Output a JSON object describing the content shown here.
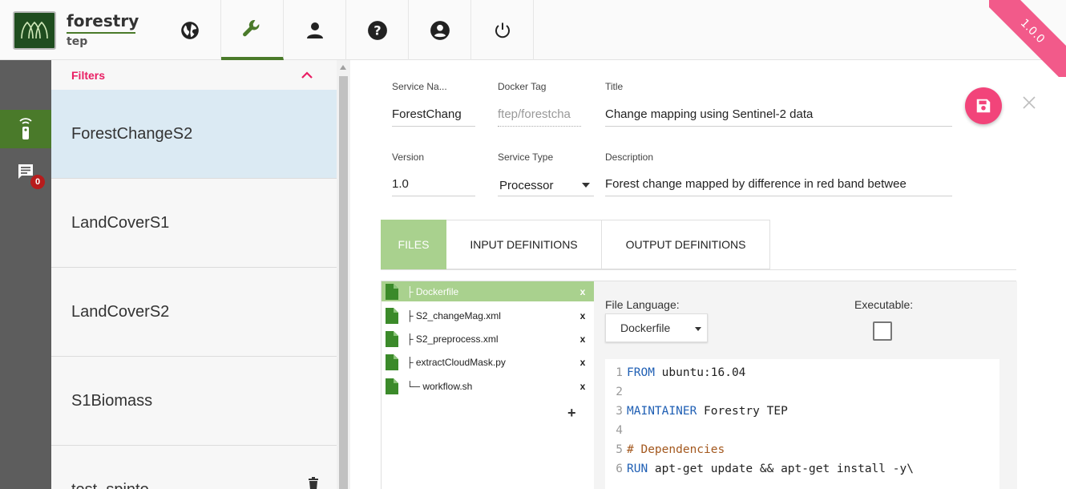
{
  "app": {
    "logo_main": "forestry",
    "logo_sub": "tep",
    "version": "1.0.0"
  },
  "nav": [
    {
      "name": "globe-icon"
    },
    {
      "name": "wrench-icon",
      "active": true
    },
    {
      "name": "user-icon"
    },
    {
      "name": "help-icon"
    },
    {
      "name": "account-circle-icon"
    },
    {
      "name": "power-icon"
    }
  ],
  "rail": {
    "message_badge": "0"
  },
  "list": {
    "filters_label": "Filters",
    "items": [
      {
        "label": "ForestChangeS2",
        "selected": true
      },
      {
        "label": "LandCoverS1"
      },
      {
        "label": "LandCoverS2"
      },
      {
        "label": "S1Biomass"
      },
      {
        "label": "test_spinto"
      }
    ]
  },
  "form": {
    "service_name_label": "Service Na...",
    "service_name": "ForestChang",
    "docker_tag_label": "Docker Tag",
    "docker_tag": "ftep/forestcha",
    "title_label": "Title",
    "title": "Change mapping using Sentinel-2 data",
    "version_label": "Version",
    "version": "1.0",
    "service_type_label": "Service Type",
    "service_type": "Processor",
    "description_label": "Description",
    "description": "Forest change mapped by difference in red band betwee"
  },
  "tabs": [
    {
      "label": "FILES",
      "active": true
    },
    {
      "label": "INPUT DEFINITIONS"
    },
    {
      "label": "OUTPUT DEFINITIONS"
    }
  ],
  "files": {
    "items": [
      {
        "name": "├ Dockerfile",
        "remove": "x",
        "active": true
      },
      {
        "name": "├ S2_changeMag.xml",
        "remove": "x"
      },
      {
        "name": "├ S2_preprocess.xml",
        "remove": "x"
      },
      {
        "name": "├ extractCloudMask.py",
        "remove": "x"
      },
      {
        "name": "└─ workflow.sh",
        "remove": "x"
      }
    ],
    "add": "+",
    "file_language_label": "File Language:",
    "file_language": "Dockerfile",
    "executable_label": "Executable:"
  },
  "code": {
    "lines": [
      {
        "n": "1",
        "kw": "FROM",
        "text": " ubuntu:16.04"
      },
      {
        "n": "2",
        "kw": "",
        "text": ""
      },
      {
        "n": "3",
        "kw": "MAINTAINER",
        "text": " Forestry TEP"
      },
      {
        "n": "4",
        "kw": "",
        "text": ""
      },
      {
        "n": "5",
        "comment": "# Dependencies"
      },
      {
        "n": "6",
        "kw": "RUN",
        "text": " apt-get update && apt-get install -y\\"
      }
    ]
  },
  "colors": {
    "accent_green": "#4a7a2a",
    "tab_green": "#a9d18e",
    "pink": "#f2447a",
    "selected_blue": "#dbeaf3"
  }
}
